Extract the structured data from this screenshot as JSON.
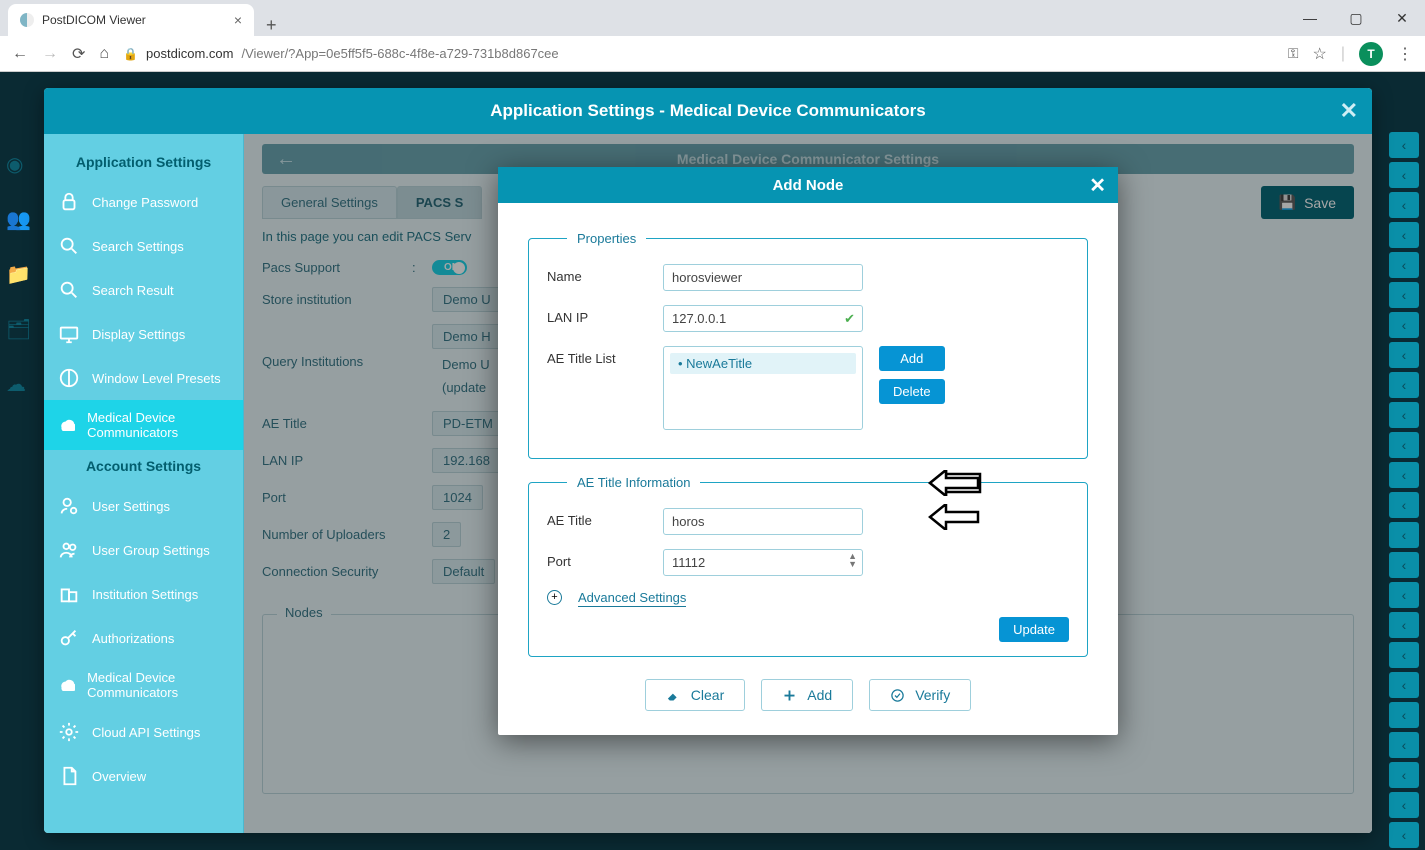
{
  "browser": {
    "tab_title": "PostDICOM Viewer",
    "url_domain": "postdicom.com",
    "url_path": "/Viewer/?App=0e5ff5f5-688c-4f8e-a729-731b8d867cee",
    "profile_letter": "T"
  },
  "settings": {
    "title": "Application Settings - Medical Device Communicators",
    "page_header": "Medical Device Communicator Settings",
    "sidebar": {
      "section1": "Application Settings",
      "section2": "Account Settings",
      "items1": [
        "Change Password",
        "Search Settings",
        "Search Result",
        "Display Settings",
        "Window Level Presets",
        "Medical Device Communicators"
      ],
      "items2": [
        "User Settings",
        "User Group Settings",
        "Institution Settings",
        "Authorizations",
        "Medical Device Communicators",
        "Cloud API Settings",
        "Overview"
      ]
    },
    "tabs": {
      "general": "General Settings",
      "pacs": "PACS S",
      "save": "Save"
    },
    "form": {
      "hint": "In this page you can edit PACS Serv",
      "pacs_support_label": "Pacs Support",
      "pacs_support_value": "ON",
      "store_inst_label": "Store institution",
      "store_inst_value": "Demo U",
      "query_inst_label": "Query Institutions",
      "query_inst_value1": "Demo H",
      "query_inst_value2": "Demo U",
      "query_inst_value3": "(update",
      "ae_title_label": "AE Title",
      "ae_title_value": "PD-ETM",
      "lanip_label": "LAN IP",
      "lanip_value": "192.168",
      "port_label": "Port",
      "port_value": "1024",
      "uploaders_label": "Number of Uploaders",
      "uploaders_value": "2",
      "connsec_label": "Connection Security",
      "connsec_value": "Default",
      "nodes_legend": "Nodes"
    }
  },
  "dialog": {
    "title": "Add Node",
    "properties_legend": "Properties",
    "name_label": "Name",
    "name_value": "horosviewer",
    "lanip_label": "LAN IP",
    "lanip_value": "127.0.0.1",
    "aetitlelist_label": "AE Title List",
    "aetitlelist_item": "NewAeTitle",
    "add_btn": "Add",
    "delete_btn": "Delete",
    "aeinfo_legend": "AE Title Information",
    "aetitle_label": "AE Title",
    "aetitle_value": "horos",
    "port_label": "Port",
    "port_value": "11112",
    "advanced": "Advanced Settings",
    "update_btn": "Update",
    "clear_btn": "Clear",
    "add_action": "Add",
    "verify_btn": "Verify"
  }
}
